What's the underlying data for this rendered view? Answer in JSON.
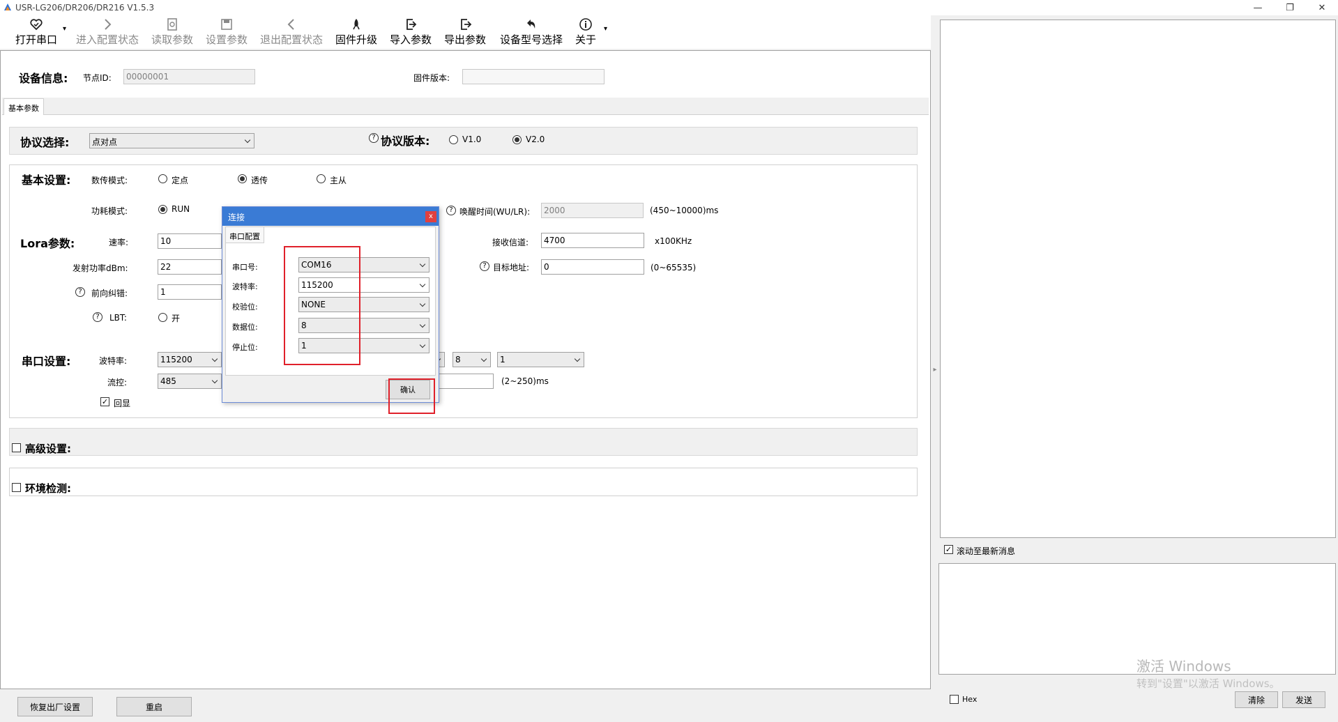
{
  "window": {
    "title": "USR-LG206/DR206/DR216 V1.5.3",
    "min": "—",
    "restore": "❐",
    "close": "✕"
  },
  "toolbar": {
    "open_port": "打开串口",
    "enter_config": "进入配置状态",
    "read_params": "读取参数",
    "set_params": "设置参数",
    "exit_config": "退出配置状态",
    "firmware_upgrade": "固件升级",
    "import_params": "导入参数",
    "export_params": "导出参数",
    "model_select": "设备型号选择",
    "about": "关于"
  },
  "device_info": {
    "label": "设备信息:",
    "node_id_label": "节点ID:",
    "node_id": "00000001",
    "firmware_label": "固件版本:",
    "firmware": ""
  },
  "tab": {
    "label": "基本参数"
  },
  "protocol": {
    "label": "协议选择:",
    "selected": "点对点",
    "version_label": "协议版本:",
    "v1": "V1.0",
    "v2": "V2.0"
  },
  "basic": {
    "label": "基本设置:",
    "transfer_mode_label": "数传模式:",
    "mode_fixed": "定点",
    "mode_transparent": "透传",
    "mode_master": "主从",
    "power_mode_label": "功耗模式:",
    "power_run": "RUN",
    "wake_label": "唤醒时间(WU/LR):",
    "wake_value": "2000",
    "wake_range": "(450~10000)ms"
  },
  "lora": {
    "label": "Lora参数:",
    "speed_label": "速率:",
    "speed": "10",
    "rx_channel_label": "接收信道:",
    "rx_channel": "4700",
    "rx_unit": "x100KHz",
    "tx_power_label": "发射功率dBm:",
    "tx_power": "22",
    "target_label": "目标地址:",
    "target": "0",
    "target_range": "(0~65535)",
    "fec_label": "前向纠错:",
    "fec": "1",
    "lbt_label": "LBT:",
    "lbt_on": "开"
  },
  "serial": {
    "label": "串口设置:",
    "baud_label": "波特率:",
    "baud": "115200",
    "flow_label": "流控:",
    "flow": "485",
    "databits": "8",
    "stopbits": "1",
    "timeout": "",
    "timeout_range": "(2~250)ms",
    "echo": "回显"
  },
  "advanced": {
    "label": "高级设置:"
  },
  "env": {
    "label": "环境检测:"
  },
  "bottom": {
    "factory_reset": "恢复出厂设置",
    "restart": "重启"
  },
  "right": {
    "scroll_latest": "滚动至最新消息",
    "hex": "Hex",
    "clear": "清除",
    "send": "发送"
  },
  "dialog": {
    "title": "连接",
    "close": "x",
    "tab": "串口配置",
    "port_label": "串口号:",
    "port": "COM16",
    "baud_label": "波特率:",
    "baud": "115200",
    "parity_label": "校验位:",
    "parity": "NONE",
    "databits_label": "数据位:",
    "databits": "8",
    "stopbits_label": "停止位:",
    "stopbits": "1",
    "confirm": "确认"
  },
  "watermark": {
    "line1": "激活 Windows",
    "line2": "转到\"设置\"以激活 Windows。"
  }
}
